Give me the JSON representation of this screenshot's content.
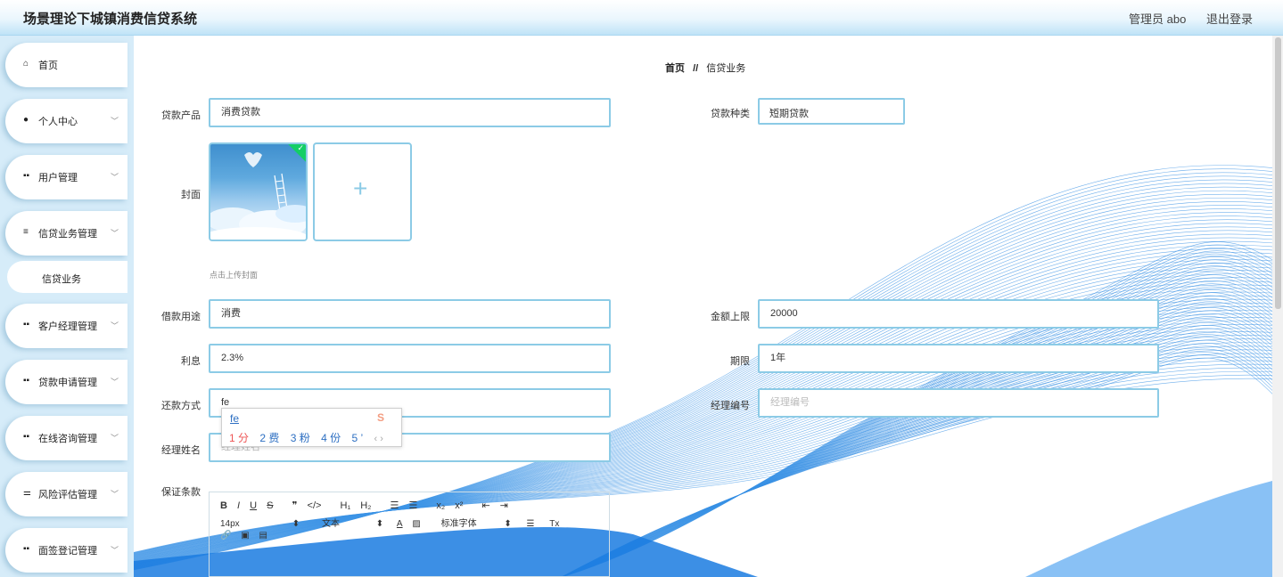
{
  "header": {
    "title": "场景理论下城镇消费信贷系统",
    "admin": "管理员 abo",
    "logout": "退出登录"
  },
  "sidebar": {
    "items": [
      {
        "label": "首页",
        "icon": "home-icon"
      },
      {
        "label": "个人中心",
        "icon": "user-icon"
      },
      {
        "label": "用户管理",
        "icon": "grid-icon"
      },
      {
        "label": "信贷业务管理",
        "icon": "list-icon"
      },
      {
        "label": "客户经理管理",
        "icon": "grid-icon"
      },
      {
        "label": "贷款申请管理",
        "icon": "grid-icon"
      },
      {
        "label": "在线咨询管理",
        "icon": "grid-icon"
      },
      {
        "label": "风险评估管理",
        "icon": "sliders-icon"
      },
      {
        "label": "面签登记管理",
        "icon": "grid-icon"
      }
    ],
    "sub_item": "信贷业务"
  },
  "breadcrumb": {
    "home": "首页",
    "separator": "//",
    "current": "信贷业务"
  },
  "form": {
    "product_label": "贷款产品",
    "product_value": "消费贷款",
    "type_label": "贷款种类",
    "type_value": "短期贷款",
    "cover_label": "封面",
    "cover_tip": "点击上传封面",
    "upload_plus": "+",
    "purpose_label": "借款用途",
    "purpose_value": "消费",
    "limit_label": "金额上限",
    "limit_value": "20000",
    "rate_label": "利息",
    "rate_value": "2.3%",
    "term_label": "期限",
    "term_value": "1年",
    "repay_label": "还款方式",
    "repay_value": "fe",
    "manager_no_label": "经理编号",
    "manager_no_placeholder": "经理编号",
    "manager_name_label": "经理姓名",
    "manager_name_placeholder": "经理姓名",
    "guarantee_label": "保证条款"
  },
  "ime": {
    "composition": "fe",
    "candidates": [
      "1 分",
      "2 费",
      "3 粉",
      "4 份",
      "5 ’"
    ],
    "arrows": "‹ ›"
  },
  "editor": {
    "row1": [
      "B",
      "I",
      "U",
      "S",
      "❞",
      "</>",
      "H₁",
      "H₂",
      "☰",
      "☰",
      "x₂",
      "x²",
      "⇤",
      "⇥"
    ],
    "size": "14px",
    "text_style": "文本",
    "font": "标准字体",
    "row3": [
      "🔗",
      "▣",
      "▤"
    ]
  },
  "colors": {
    "accent_border": "#8ccbe6",
    "sidebar_bg": "#d6ecf9",
    "wave_blue": "#1e88e5"
  }
}
